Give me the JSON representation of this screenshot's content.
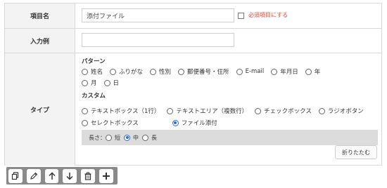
{
  "fields": {
    "item_name": {
      "label": "項目名",
      "value": "添付ファイル",
      "required_checkbox_label": "必須項目にする",
      "required_checked": false
    },
    "input_example": {
      "label": "入力例",
      "value": ""
    },
    "type": {
      "label": "タイプ",
      "pattern_title": "パターン",
      "pattern_options": [
        "姓名",
        "ふりがな",
        "性別",
        "郵便番号・住所",
        "E-mail",
        "年月日",
        "年",
        "月",
        "日"
      ],
      "custom_title": "カスタム",
      "custom_options": [
        "テキストボックス（1行）",
        "テキストエリア（複数行）",
        "チェックボックス",
        "ラジオボタン",
        "セレクトボックス",
        "ファイル添付"
      ],
      "selected": "ファイル添付"
    },
    "length": {
      "label": "長さ：",
      "options": [
        "短",
        "中",
        "長"
      ],
      "selected": "中"
    }
  },
  "fold_button_label": "折りたたむ",
  "toolbar": {
    "buttons": [
      "copy-icon",
      "pencil-icon",
      "arrow-up-icon",
      "arrow-down-icon",
      "trash-icon",
      "plus-icon"
    ]
  },
  "colors": {
    "accent": "#2b6de0",
    "required": "#e2473a",
    "label_bg": "#f3f3f3",
    "length_bg": "#dcdcdc",
    "toolbar_bg": "#8a8a8a"
  }
}
